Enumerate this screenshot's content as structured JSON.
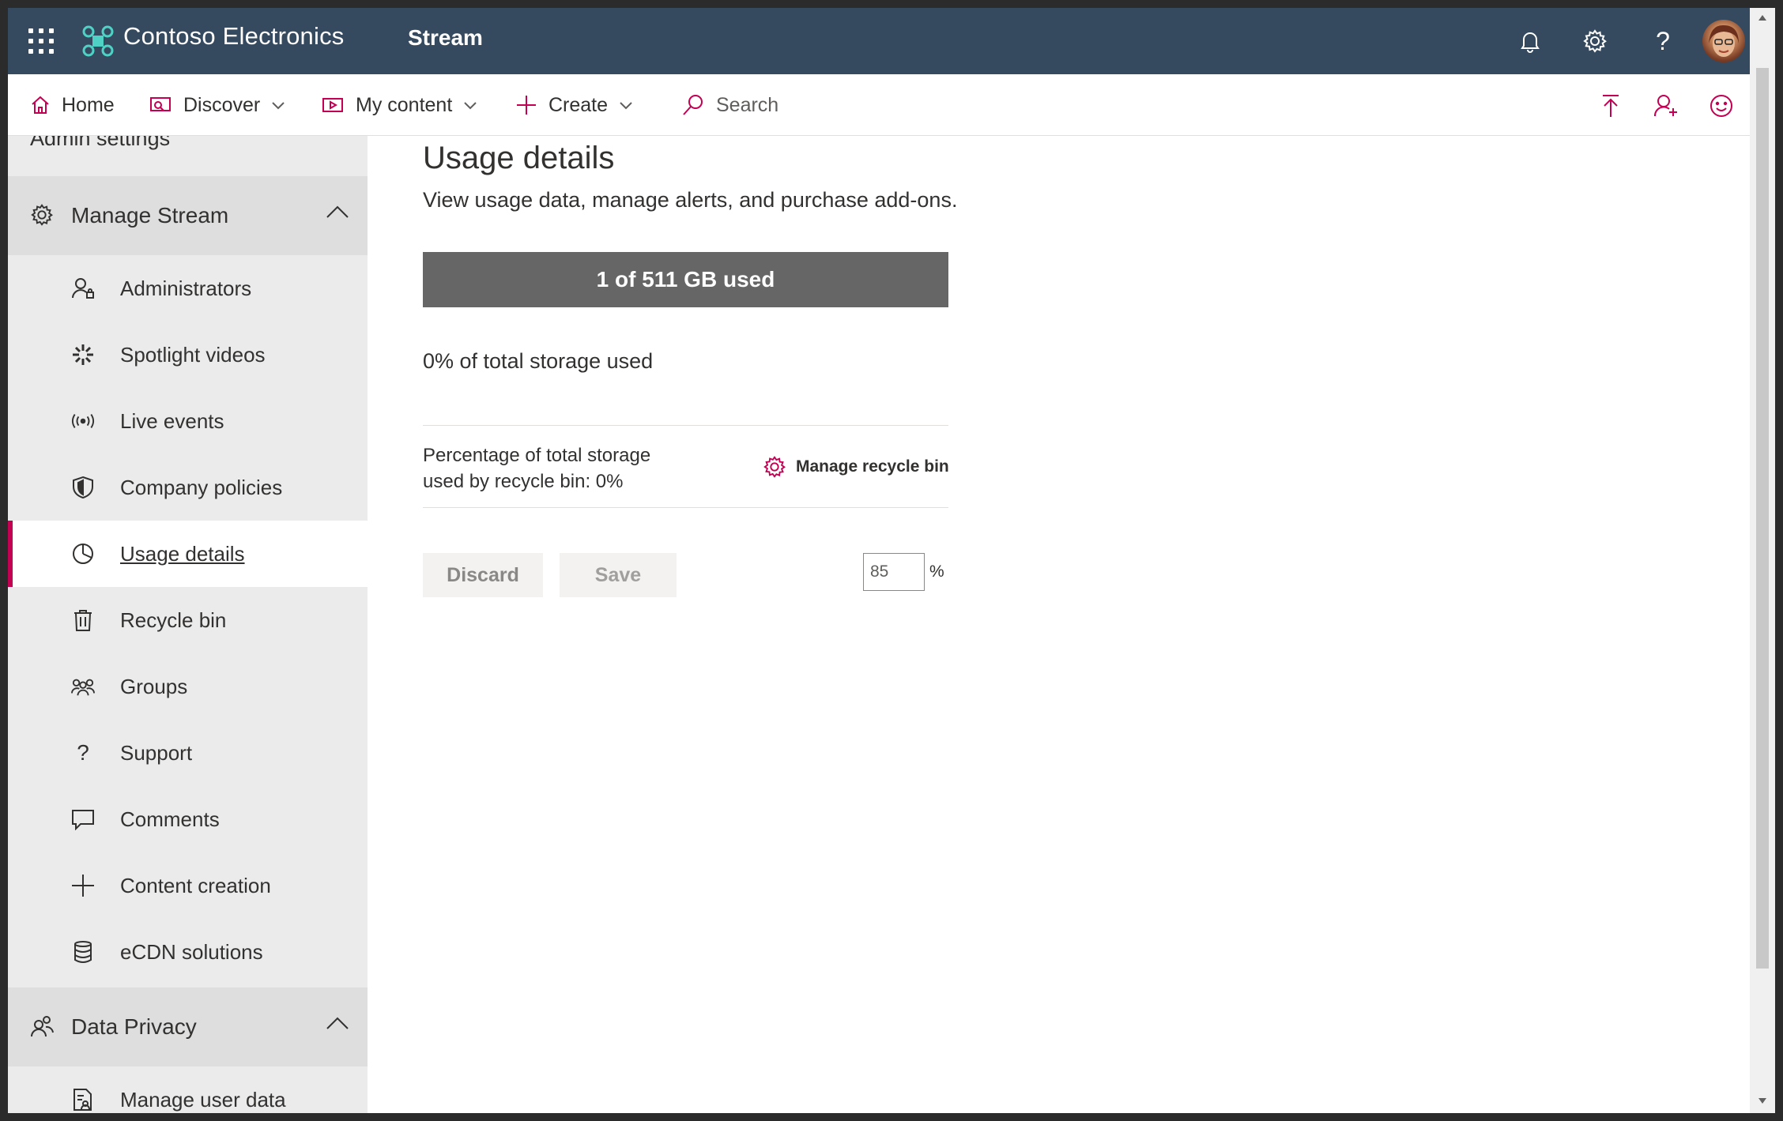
{
  "topbar": {
    "brand_name": "Contoso Electronics",
    "app_name": "Stream",
    "bg_color": "#354a5f"
  },
  "nav": {
    "home": "Home",
    "discover": "Discover",
    "my_content": "My content",
    "create": "Create",
    "search_placeholder": "Search",
    "accent_color": "#c30052"
  },
  "sidebar": {
    "admin_settings": "Admin settings",
    "manage_stream": {
      "label": "Manage Stream",
      "items": [
        {
          "label": "Administrators",
          "icon": "admin-user-icon"
        },
        {
          "label": "Spotlight videos",
          "icon": "spotlight-icon"
        },
        {
          "label": "Live events",
          "icon": "live-broadcast-icon"
        },
        {
          "label": "Company policies",
          "icon": "shield-icon"
        },
        {
          "label": "Usage details",
          "icon": "pie-chart-icon",
          "active": true
        },
        {
          "label": "Recycle bin",
          "icon": "trash-icon"
        },
        {
          "label": "Groups",
          "icon": "groups-icon"
        },
        {
          "label": "Support",
          "icon": "question-icon"
        },
        {
          "label": "Comments",
          "icon": "comment-icon"
        },
        {
          "label": "Content creation",
          "icon": "plus-icon"
        },
        {
          "label": "eCDN solutions",
          "icon": "database-icon"
        }
      ]
    },
    "data_privacy": {
      "label": "Data Privacy",
      "items": [
        {
          "label": "Manage user data",
          "icon": "user-report-icon"
        }
      ]
    }
  },
  "main": {
    "title": "Usage details",
    "subtitle": "View usage data, manage alerts, and purchase add-ons.",
    "storage_bar_label": "1 of 511 GB used",
    "storage_used_fraction": 0.0,
    "storage_percent_text": "0% of total storage used",
    "recycle_text": "Percentage of total storage used by recycle bin: 0%",
    "manage_recycle_label": "Manage recycle bin",
    "discard_label": "Discard",
    "save_label": "Save",
    "threshold_value": "85",
    "threshold_unit": "%"
  }
}
